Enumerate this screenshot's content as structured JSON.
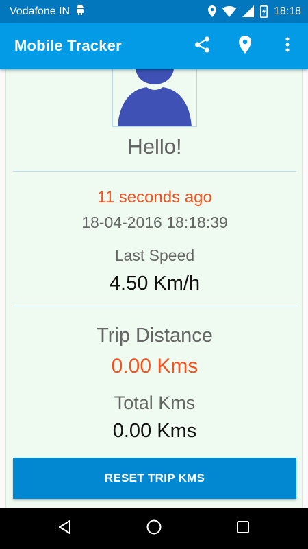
{
  "status_bar": {
    "carrier": "Vodafone IN",
    "time": "18:18",
    "icons": [
      "android-icon",
      "location-icon",
      "wifi-icon",
      "signal-icon",
      "battery-charging-icon"
    ]
  },
  "app_bar": {
    "title": "Mobile Tracker",
    "actions": [
      "share-icon",
      "map-pin-icon",
      "more-vert-icon"
    ]
  },
  "profile": {
    "greeting": "Hello!"
  },
  "last_update": {
    "relative": "11 seconds ago",
    "timestamp": "18-04-2016 18:18:39"
  },
  "speed": {
    "label": "Last Speed",
    "value": "4.50 Km/h"
  },
  "trip": {
    "label": "Trip Distance",
    "value": "0.00 Kms"
  },
  "total": {
    "label": "Total Kms",
    "value": "0.00 Kms"
  },
  "reset_button": {
    "label": "RESET TRIP KMS"
  },
  "colors": {
    "status_bar": "#0277bd",
    "app_bar": "#039be5",
    "card_bg": "#effbf0",
    "accent_orange": "#f4511e",
    "avatar": "#3f51b5",
    "button": "#0288d1"
  },
  "nav_bar": {
    "icons": [
      "back-icon",
      "home-icon",
      "recents-icon"
    ]
  }
}
